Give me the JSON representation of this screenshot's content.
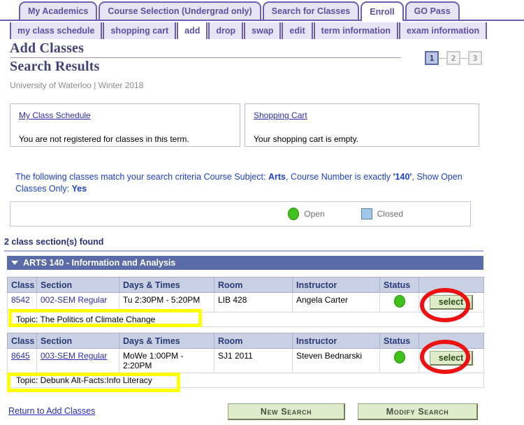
{
  "main_tabs": [
    {
      "label": "My Academics",
      "active": false
    },
    {
      "label": "Course Selection (Undergrad only)",
      "active": false
    },
    {
      "label": "Search for Classes",
      "active": false
    },
    {
      "label": "Enroll",
      "active": true
    },
    {
      "label": "GO Pass",
      "active": false
    }
  ],
  "sub_tabs": [
    {
      "label": "my class schedule",
      "active": false
    },
    {
      "label": "shopping cart",
      "active": false
    },
    {
      "label": "add",
      "active": true
    },
    {
      "label": "drop",
      "active": false
    },
    {
      "label": "swap",
      "active": false
    },
    {
      "label": "edit",
      "active": false
    },
    {
      "label": "term information",
      "active": false
    },
    {
      "label": "exam information",
      "active": false
    }
  ],
  "header": {
    "title": "Add Classes",
    "subtitle": "Search Results",
    "term_line": "University of Waterloo | Winter 2018"
  },
  "steps": [
    {
      "label": "1",
      "active": true
    },
    {
      "label": "2",
      "active": false
    },
    {
      "label": "3",
      "active": false
    }
  ],
  "boxes": {
    "schedule": {
      "link": "My Class Schedule",
      "note": "You are not registered for classes in this term."
    },
    "cart": {
      "link": "Shopping Cart",
      "note": "Your shopping cart is empty."
    }
  },
  "criteria": {
    "lead": "The following classes match your search criteria",
    "subject_label": "Course Subject:",
    "subject_value": "Arts",
    "number_label": "Course Number is exactly",
    "number_value": "'140'",
    "open_label": "Show Open Classes Only:",
    "open_value": "Yes"
  },
  "legend": {
    "open": "Open",
    "closed": "Closed",
    "open_color": "#3fc11c",
    "closed_color": "#9ec9ea"
  },
  "results": {
    "count_text": "2 class section(s) found",
    "course_header": "ARTS 140 - Information and Analysis",
    "columns": [
      "Class",
      "Section",
      "Days & Times",
      "Room",
      "Instructor",
      "Status",
      ""
    ],
    "rows": [
      {
        "class": "8542",
        "section": "002-SEM Regular",
        "days_times": "Tu 2:30PM - 5:20PM",
        "room": "LIB 428",
        "instructor": "Angela Carter",
        "status": "open",
        "select_label": "select",
        "topic": "Topic: The Politics of Climate Change"
      },
      {
        "class": "8645",
        "section": "003-SEM Regular",
        "days_times": "MoWe 1:00PM - 2:20PM",
        "room": "SJ1  2011",
        "instructor": "Steven Bednarski",
        "status": "open",
        "select_label": "select",
        "topic": "Topic: Debunk Alt-Facts:Info Literacy"
      }
    ]
  },
  "footer": {
    "return_link": "Return to Add Classes",
    "new_search": "New Search",
    "modify_search": "Modify Search"
  },
  "annotations": {
    "highlight_color": "#ffff00",
    "circle_color": "#ee1111"
  }
}
